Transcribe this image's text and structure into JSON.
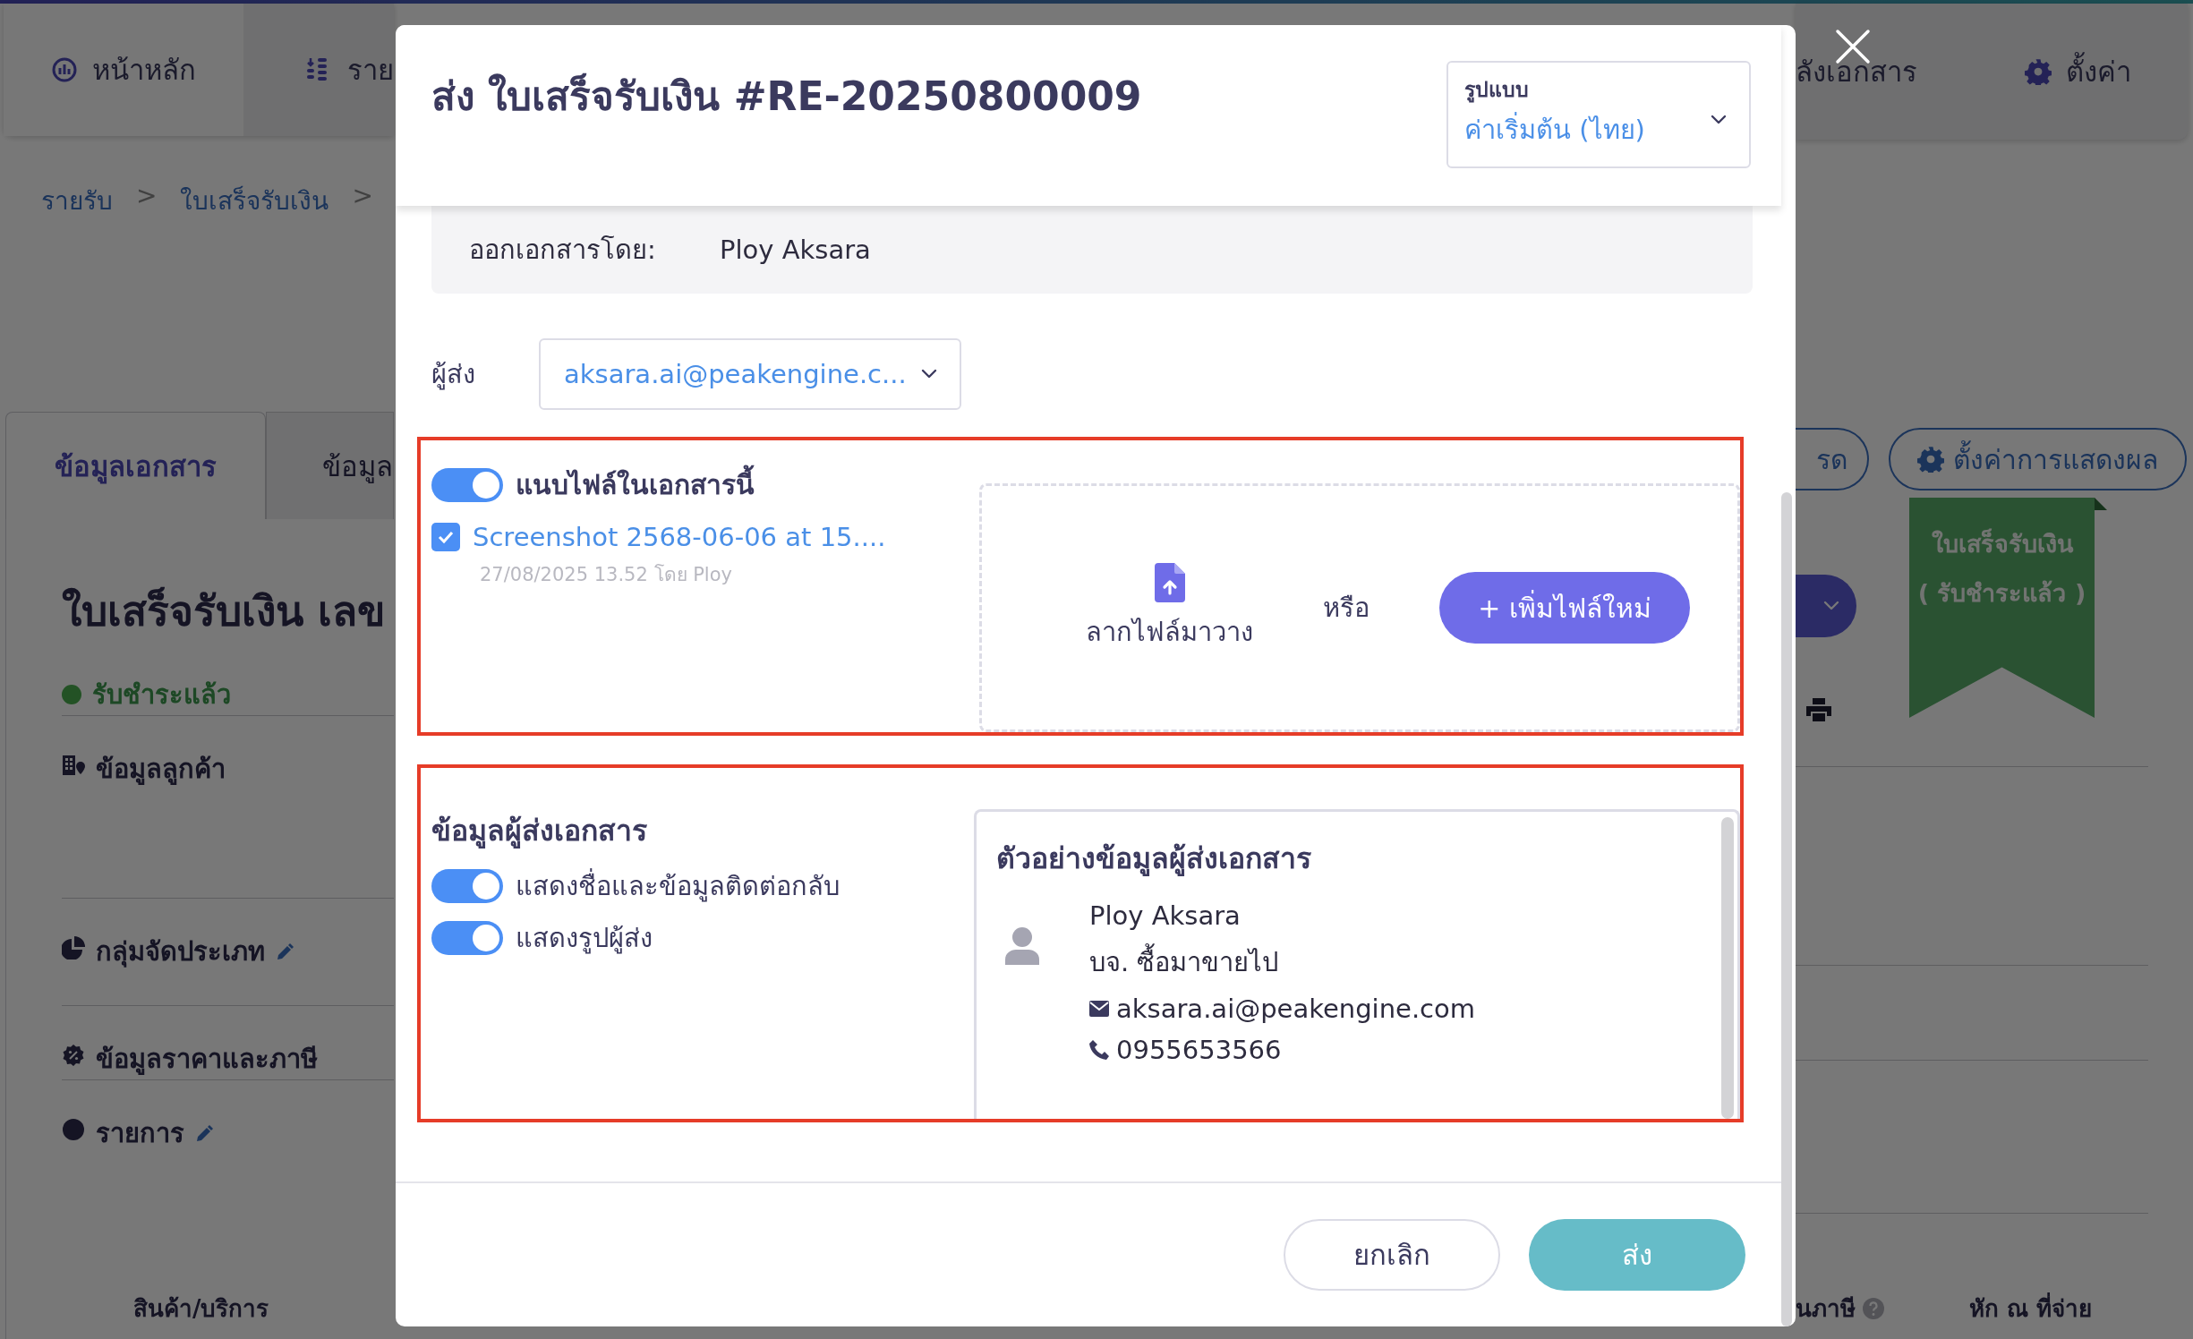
{
  "background": {
    "nav_left": [
      {
        "label": "หน้าหลัก"
      },
      {
        "label": "ราย"
      }
    ],
    "nav_right": [
      {
        "label": "ลังเอกสาร"
      },
      {
        "label": "ตั้งค่า"
      }
    ],
    "breadcrumb": [
      {
        "kind": "link",
        "text": "รายรับ"
      },
      {
        "kind": "separator",
        "text": ">"
      },
      {
        "kind": "link",
        "text": "ใบเสร็จรับเงิน"
      },
      {
        "kind": "separator",
        "text": ">"
      }
    ],
    "tabs": [
      {
        "label": "ข้อมูลเอกสาร",
        "selected": true
      },
      {
        "label": "ข้อมูล",
        "selected": false
      }
    ],
    "doc_title": "ใบเสร็จรับเงิน เลข",
    "status": {
      "label": "รับชำระแล้ว"
    },
    "sections": [
      {
        "label": "ข้อมูลลูกค้า",
        "editable": false
      },
      {
        "label": "กลุ่มจัดประเภท",
        "editable": true
      },
      {
        "label": "ข้อมูลราคาและภาษี",
        "editable": false
      },
      {
        "label": "รายการ",
        "editable": true
      }
    ],
    "action_buttons": [
      "รด",
      "ตั้งค่าการแสดงผล"
    ],
    "ribbon": {
      "title": "ใบเสร็จรับเงิน",
      "status": "( รับชำระแล้ว )"
    },
    "table_columns_left": [
      "สินค้า/บริการ"
    ],
    "table_columns_right": [
      {
        "label": "นภาษี",
        "help": true
      },
      {
        "label": "หัก ณ ที่จ่าย",
        "help": false
      }
    ]
  },
  "modal": {
    "title": "ส่ง ใบเสร็จรับเงิน #RE-20250800009",
    "format": {
      "label": "รูปแบบ",
      "value": "ค่าเริ่มต้น (ไทย)"
    },
    "issued_by": {
      "label": "ออกเอกสารโดย:",
      "value": "Ploy Aksara"
    },
    "sender": {
      "label": "ผู้ส่ง",
      "value": "aksara.ai@peakengine.c..."
    },
    "attachments": {
      "label": "แนบไฟล์ในเอกสารนี้",
      "on": true,
      "highlighted": true,
      "files": [
        {
          "name": "Screenshot 2568-06-06 at 15....",
          "meta": "27/08/2025 13.52 โดย Ploy",
          "checked": true
        }
      ],
      "drop_hint": "ลากไฟล์มาวาง",
      "or": "หรือ",
      "add_button": "+ เพิ่มไฟล์ใหม่"
    },
    "sender_info": {
      "title": "ข้อมูลผู้ส่งเอกสาร",
      "highlighted": true,
      "options": [
        {
          "label": "แสดงชื่อและข้อมูลติดต่อกลับ",
          "on": true
        },
        {
          "label": "แสดงรูปผู้ส่ง",
          "on": true
        }
      ],
      "preview": {
        "title": "ตัวอย่างข้อมูลผู้ส่งเอกสาร",
        "name": "Ploy Aksara",
        "company": "บจ. ซื้อมาขายไป",
        "email": "aksara.ai@peakengine.com",
        "phone": "0955653566"
      }
    },
    "buttons": [
      {
        "label": "ยกเลิก",
        "kind": "secondary"
      },
      {
        "label": "ส่ง",
        "kind": "primary"
      }
    ]
  }
}
